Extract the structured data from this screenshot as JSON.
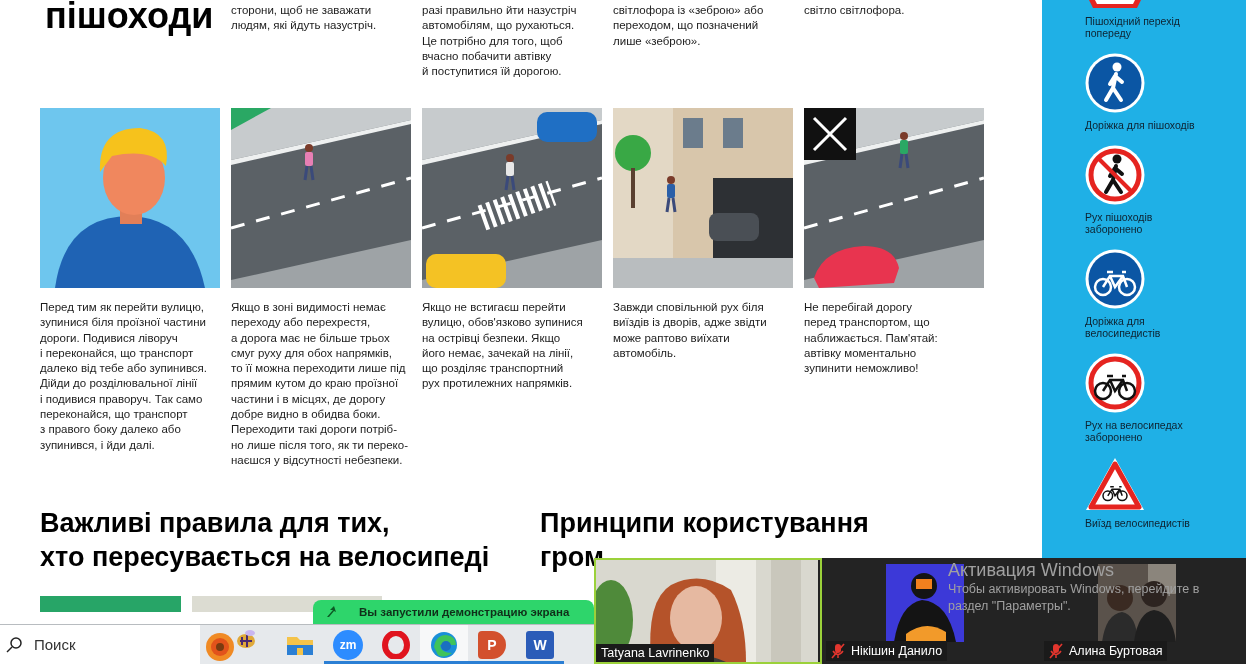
{
  "article": {
    "heading": "пішоходи",
    "top_columns": [
      {
        "lines": [
          "сторони, щоб не заважати",
          "людям, які йдуть назустріч."
        ]
      },
      {
        "lines": [
          "разі правильно йти назустріч",
          "автомобілям, що рухаються.",
          "Це потрібно для того, щоб",
          "вчасно побачити автівку",
          "й поступитися їй дорогою."
        ]
      },
      {
        "lines": [
          "світлофора із «зеброю» або",
          "переходом, що позначений",
          "лише «зеброю»."
        ]
      },
      {
        "lines": [
          "світло світлофора."
        ]
      }
    ],
    "illustrations": [
      {
        "kind": "person",
        "crossed": false
      },
      {
        "kind": "street",
        "crossed": false
      },
      {
        "kind": "zebra",
        "crossed": false
      },
      {
        "kind": "yard",
        "crossed": false
      },
      {
        "kind": "car",
        "crossed": true
      }
    ],
    "tips": [
      {
        "lines": [
          "Перед тим як перейти вулицю,",
          "зупинися біля проїзної частини",
          "дороги. Подивися ліворуч",
          "і переконайся, що транспорт",
          "далеко від тебе або зупинився.",
          "Дійди до розділювальної лінії",
          "і подивися праворуч. Так само",
          "переконайся, що транспорт",
          "з правого боку далеко або",
          "зупинився, і йди далі."
        ]
      },
      {
        "lines": [
          "Якщо в зоні видимості немає",
          "переходу або перехрестя,",
          "а дорога має не більше трьох",
          "смуг руху для обох напрямків,",
          "то її можна переходити лише під",
          "прямим кутом до краю проїзної",
          "частини і в місцях, де дорогу",
          "добре видно в обидва боки.",
          "Переходити такі дороги потріб-",
          "но лише після того, як ти переко-",
          "наєшся у відсутності небезпеки."
        ]
      },
      {
        "lines": [
          "Якщо не встигаєш перейти",
          "вулицю, обов'язково зупинися",
          "на острівці безпеки. Якщо",
          "його немає, зачекай на лінії,",
          "що розділяє транспортний",
          "рух протилежних напрямків."
        ]
      },
      {
        "lines": [
          "Завжди сповільнюй рух біля",
          "виїздів із дворів, адже звідти",
          "може раптово виїхати",
          "автомобіль."
        ]
      },
      {
        "lines": [
          "Не перебігай дорогу",
          "перед транспортом, що",
          "наближається. Пам'ятай:",
          "автівку моментально",
          "зупинити неможливо!"
        ]
      }
    ],
    "section_headings": [
      {
        "lines": [
          "Важливі правила для тих,",
          "хто пересувається на велосипеді"
        ]
      },
      {
        "lines": [
          "Принципи користування",
          "гром"
        ]
      }
    ],
    "section_bars": [
      {
        "color": "#27a567"
      },
      {
        "color": "#dcdcd2"
      }
    ]
  },
  "sidebar": {
    "signs": [
      {
        "kind": "cut-triangle",
        "label": "Пішохідний перехід\nпопереду"
      },
      {
        "kind": "pedestrian-path",
        "label": "Доріжка для пішоходів"
      },
      {
        "kind": "no-pedestrians",
        "label": "Рух пішоходів\nзаборонено"
      },
      {
        "kind": "bicycle-path",
        "label": "Доріжка для\nвелосипедистів"
      },
      {
        "kind": "no-bicycles",
        "label": "Рух на велосипедах\nзаборонено"
      },
      {
        "kind": "bicycle-crossing",
        "label": "Виїзд велосипедистів"
      }
    ]
  },
  "share_notice": {
    "text": "Вы запустили демонстрацию экрана"
  },
  "taskbar": {
    "search": {
      "placeholder": "Поиск"
    },
    "apps": [
      {
        "kind": "folder",
        "selected": false,
        "running": false
      },
      {
        "kind": "zoom",
        "glyph": "zm",
        "selected": false,
        "running": true
      },
      {
        "kind": "opera",
        "selected": false,
        "running": true
      },
      {
        "kind": "edge",
        "selected": true,
        "running": true
      },
      {
        "kind": "powerpoint",
        "glyph": "P",
        "selected": false,
        "running": true
      },
      {
        "kind": "word",
        "glyph": "W",
        "selected": false,
        "running": true
      }
    ]
  },
  "meeting": {
    "participants": [
      {
        "kind": "video",
        "name": "Tatyana Lavrinenko",
        "muted": false,
        "speaking": true
      },
      {
        "kind": "avatar",
        "name": "Нікішин Данило",
        "muted": true,
        "speaking": false
      },
      {
        "kind": "avatar",
        "name": "Алина Буртовая",
        "muted": true,
        "speaking": false
      }
    ],
    "activation_notice": {
      "title": "Активация Windows",
      "lines": [
        "Чтобы активировать Windows, перейдите в",
        "раздел \"Параметры\"."
      ]
    }
  }
}
